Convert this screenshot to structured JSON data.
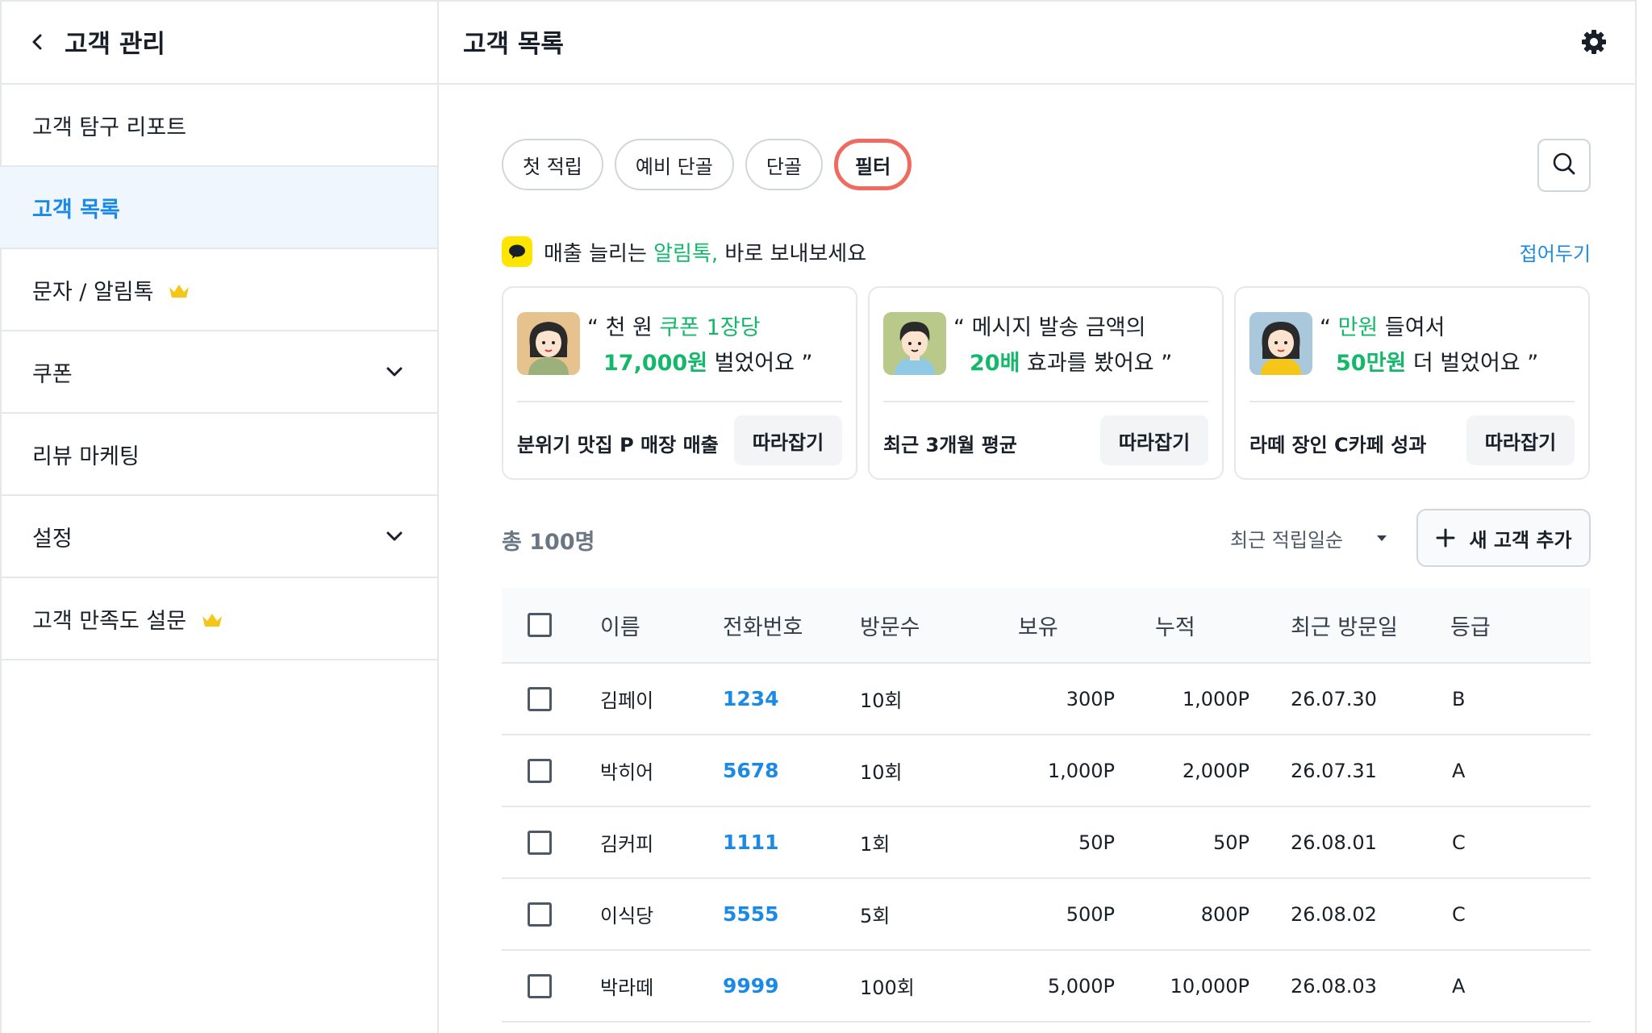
{
  "sidebar": {
    "title": "고객 관리",
    "items": [
      {
        "label": "고객 탐구 리포트"
      },
      {
        "label": "고객 목록"
      },
      {
        "label": "문자 / 알림톡"
      },
      {
        "label": "쿠폰"
      },
      {
        "label": "리뷰 마케팅"
      },
      {
        "label": "설정"
      },
      {
        "label": "고객 만족도 설문"
      }
    ]
  },
  "main": {
    "title": "고객 목록",
    "chips": [
      "첫 적립",
      "예비 단골",
      "단골",
      "필터"
    ],
    "banner": {
      "text_before": "매출 늘리는 ",
      "highlight": "알림톡,",
      "text_after": " 바로 보내보세요",
      "fold": "접어두기"
    },
    "cards": [
      {
        "q1_pre": "“ 천 원 ",
        "q1_hl": "쿠폰 1장당",
        "q1_post": "",
        "q2_hl": "17,000원",
        "q2_post": " 벌었어요 ”",
        "caption": "분위기 맛집 P 매장 매출",
        "button": "따라잡기"
      },
      {
        "q1_pre": "“ 메시지 발송 금액의",
        "q1_hl": "",
        "q1_post": "",
        "q2_hl": "20배",
        "q2_post": " 효과를 봤어요  ”",
        "caption": "최근 3개월 평균",
        "button": "따라잡기"
      },
      {
        "q1_pre": "“ ",
        "q1_hl": "만원",
        "q1_post": " 들여서",
        "q2_hl": "50만원",
        "q2_post": " 더 벌었어요 ”",
        "caption": "라떼 장인 C카페 성과",
        "button": "따라잡기"
      }
    ],
    "total": "총 100명",
    "sort": "최근 적립일순",
    "add_button": "새 고객 추가",
    "table": {
      "headers": [
        "이름",
        "전화번호",
        "방문수",
        "보유",
        "누적",
        "최근 방문일",
        "등급"
      ],
      "rows": [
        [
          "김페이",
          "1234",
          "10회",
          "300P",
          "1,000P",
          "26.07.30",
          "B"
        ],
        [
          "박히어",
          "5678",
          "10회",
          "1,000P",
          "2,000P",
          "26.07.31",
          "A"
        ],
        [
          "김커피",
          "1111",
          "1회",
          "50P",
          "50P",
          "26.08.01",
          "C"
        ],
        [
          "이식당",
          "5555",
          "5회",
          "500P",
          "800P",
          "26.08.02",
          "C"
        ],
        [
          "박라떼",
          "9999",
          "100회",
          "5,000P",
          "10,000P",
          "26.08.03",
          "A"
        ]
      ]
    }
  },
  "colors": {
    "accent_blue": "#1b8ae6",
    "highlight_green": "#15b86b",
    "filter_ring": "#ef6a5f",
    "crown": "#f5c518",
    "talk_yellow": "#fee500"
  },
  "icons": {
    "back": "chevron-left-icon",
    "settings": "gear-icon",
    "premium": "crown-icon",
    "expand": "chevron-down-icon",
    "search": "search-icon",
    "talk": "chat-bubble-icon",
    "add": "plus-icon"
  }
}
